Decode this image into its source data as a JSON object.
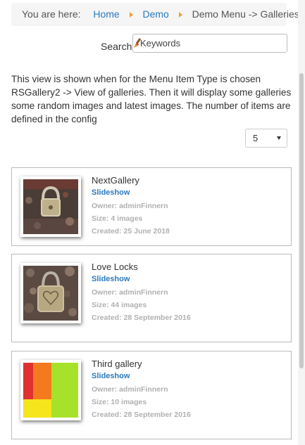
{
  "breadcrumb": {
    "prefix": "You are here:",
    "items": [
      {
        "label": "Home"
      },
      {
        "label": "Demo"
      },
      {
        "label": "Demo Menu -> Galleries"
      }
    ],
    "divider_color": "#e8a33d",
    "link_color": "#2a7abf"
  },
  "search": {
    "label": "Search",
    "placeholder": "Keywords",
    "icon": "brush-icon"
  },
  "intro_text": "This view is shown when for the Menu Item Type is chosen RSGallery2 -> View of galleries. Then it will display some galleries some random images and latest images. The number of items are defined in the config",
  "limit_select": {
    "value": "5"
  },
  "galleries": [
    {
      "title": "NextGallery",
      "slideshow_label": "Slideshow",
      "owner": "Owner: adminFinnern",
      "size": "Size: 4 images",
      "created": "Created: 25 June 2018",
      "thumbnail": "padlock-photo"
    },
    {
      "title": "Love Locks",
      "slideshow_label": "Slideshow",
      "owner": "Owner: adminFinnern",
      "size": "Size: 44 images",
      "created": "Created: 28 September 2016",
      "thumbnail": "heart-padlock-photo"
    },
    {
      "title": "Third gallery",
      "slideshow_label": "Slideshow",
      "owner": "Owner: adminFinnern",
      "size": "Size: 10 images",
      "created": "Created: 28 September 2016",
      "thumbnail": "color-blocks"
    }
  ]
}
